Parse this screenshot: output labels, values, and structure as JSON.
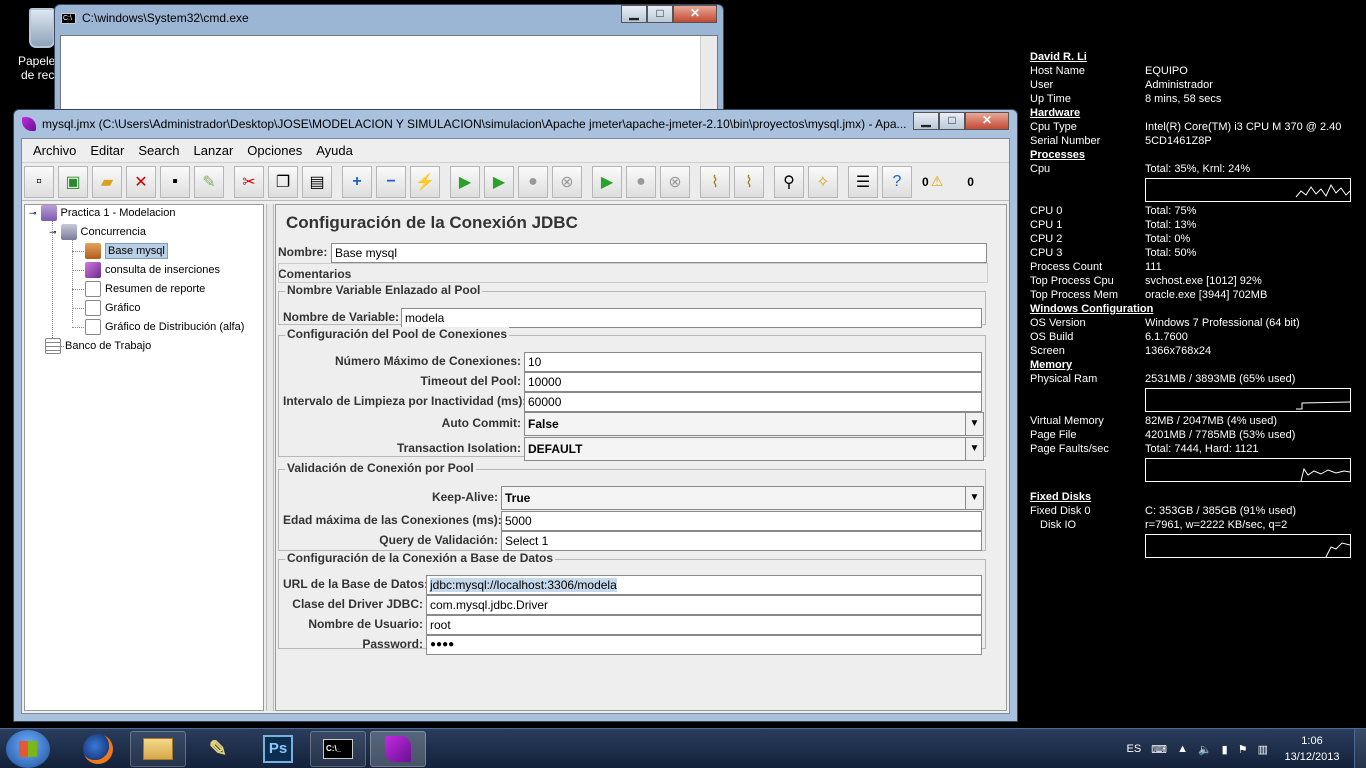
{
  "desktop": {
    "recycle_label": "Papelera de recic"
  },
  "bginfo": {
    "user_header": "David R. Li",
    "host_name_k": "Host Name",
    "host_name_v": "EQUIPO",
    "user_k": "User",
    "user_v": "Administrador",
    "uptime_k": "Up Time",
    "uptime_v": "8 mins, 58 secs",
    "hardware": "Hardware",
    "cpu_type_k": "Cpu Type",
    "cpu_type_v": "Intel(R) Core(TM) i3 CPU       M 370  @ 2.40",
    "serial_k": "Serial Number",
    "serial_v": "5CD1461Z8P",
    "processes": "Processes",
    "cpu_k": "Cpu",
    "cpu_v": "Total: 35%, Krnl: 24%",
    "cpu0_k": "CPU 0",
    "cpu0_v": "Total: 75%",
    "cpu1_k": "CPU 1",
    "cpu1_v": "Total: 13%",
    "cpu2_k": "CPU 2",
    "cpu2_v": "Total: 0%",
    "cpu3_k": "CPU 3",
    "cpu3_v": "Total: 50%",
    "pcount_k": "Process Count",
    "pcount_v": "111",
    "topcpu_k": "Top Process Cpu",
    "topcpu_v": "svchost.exe [1012] 92%",
    "topmem_k": "Top Process Mem",
    "topmem_v": "oracle.exe [3944] 702MB",
    "wincfg": "Windows Configuration",
    "osver_k": "OS Version",
    "osver_v": "Windows 7 Professional (64 bit)",
    "osbuild_k": "OS Build",
    "osbuild_v": "6.1.7600",
    "screen_k": "Screen",
    "screen_v": "1366x768x24",
    "memory": "Memory",
    "pram_k": "Physical Ram",
    "pram_v": "2531MB / 3893MB (65% used)",
    "vmem_k": "Virtual Memory",
    "vmem_v": "82MB / 2047MB (4% used)",
    "pfile_k": "Page File",
    "pfile_v": "4201MB / 7785MB (53% used)",
    "pfault_k": "Page Faults/sec",
    "pfault_v": "Total: 7444, Hard: 1121",
    "fixed": "Fixed Disks",
    "fd0_k": "Fixed Disk 0",
    "fd0_v": "C: 353GB / 385GB (91% used)",
    "dio_k": "Disk IO",
    "dio_v": "r=7961, w=2222 KB/sec, q=2"
  },
  "cmd": {
    "title": "C:\\windows\\System32\\cmd.exe"
  },
  "jmeter": {
    "title": "mysql.jmx (C:\\Users\\Administrador\\Desktop\\JOSE\\MODELACION Y SIMULACION\\simulacion\\Apache jmeter\\apache-jmeter-2.10\\bin\\proyectos\\mysql.jmx) - Apa...",
    "menu": [
      "Archivo",
      "Editar",
      "Search",
      "Lanzar",
      "Opciones",
      "Ayuda"
    ],
    "counter_left": "0",
    "counter_right": "0",
    "tree": {
      "plan": "Practica 1 - Modelacion",
      "group": "Concurrencia",
      "config": "Base mysql",
      "sampler": "consulta de inserciones",
      "report": "Resumen de reporte",
      "graph": "Gráfico",
      "dist": "Gráfico de Distribución (alfa)",
      "workbench": "Banco de Trabajo"
    },
    "form": {
      "title": "Configuración de la Conexión JDBC",
      "name_label": "Nombre:",
      "name_value": "Base mysql",
      "comments_label": "Comentarios",
      "g1_title": "Nombre Variable Enlazado al Pool",
      "var_label": "Nombre de Variable:",
      "var_value": "modela",
      "g2_title": "Configuración del Pool de Conexiones",
      "max_label": "Número Máximo de Conexiones:",
      "max_value": "10",
      "timeout_label": "Timeout del Pool:",
      "timeout_value": "10000",
      "interval_label": "Intervalo de Limpieza por Inactividad (ms):",
      "interval_value": "60000",
      "autocommit_label": "Auto Commit:",
      "autocommit_value": "False",
      "isolation_label": "Transaction Isolation:",
      "isolation_value": "DEFAULT",
      "g3_title": "Validación de Conexión por Pool",
      "keepalive_label": "Keep-Alive:",
      "keepalive_value": "True",
      "maxage_label": "Edad máxima de las Conexiones (ms):",
      "maxage_value": "5000",
      "query_label": "Query de Validación:",
      "query_value": "Select 1",
      "g4_title": "Configuración de la Conexión a Base de Datos",
      "url_label": "URL de la Base de Datos:",
      "url_value": "jdbc:mysql://localhost:3306/modela",
      "driver_label": "Clase del Driver JDBC:",
      "driver_value": "com.mysql.jdbc.Driver",
      "user_label": "Nombre de Usuario:",
      "user_value": "root",
      "pass_label": "Password:",
      "pass_value": "●●●●"
    }
  },
  "taskbar": {
    "ps": "Ps",
    "lang": "ES",
    "time": "1:06",
    "date": "13/12/2013"
  },
  "colors": {
    "selection": "#b8cfe5",
    "window_frame": "#a9c1dc",
    "taskbar": "#1e2f4c"
  }
}
